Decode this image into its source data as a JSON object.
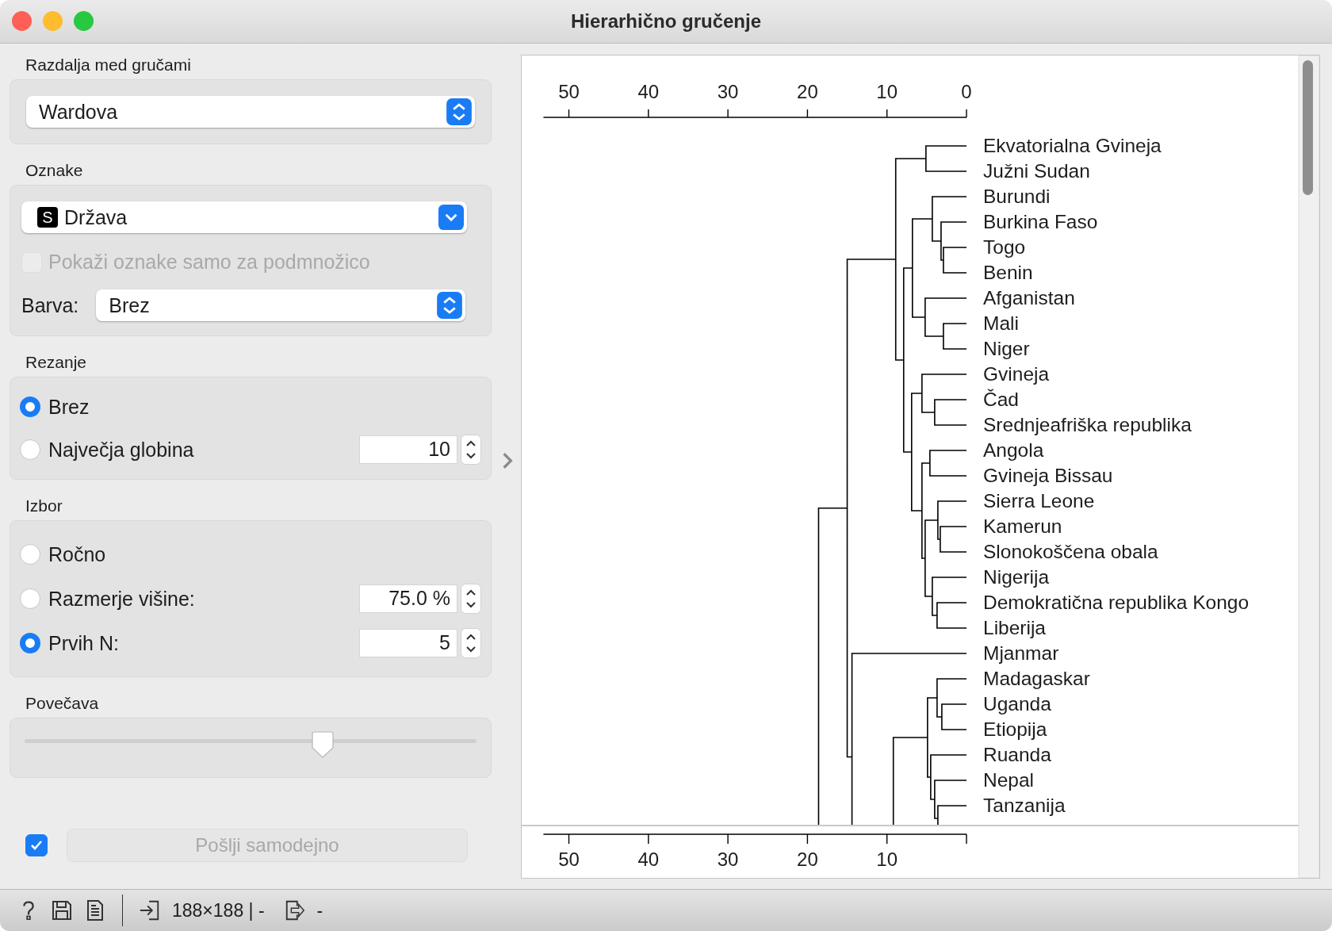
{
  "window": {
    "title": "Hierarhično gručenje"
  },
  "linkage": {
    "label": "Razdalja med gručami",
    "value": "Wardova"
  },
  "annotations": {
    "label": "Oznake",
    "type_badge": "S",
    "value": "Država",
    "subset_checkbox": {
      "label": "Pokaži oznake samo za podmnožico",
      "checked": false,
      "disabled": true
    },
    "color": {
      "label": "Barva:",
      "value": "Brez"
    }
  },
  "pruning": {
    "label": "Rezanje",
    "options": [
      {
        "label": "Brez",
        "selected": true
      },
      {
        "label": "Največja globina",
        "selected": false,
        "value": "10"
      }
    ]
  },
  "selection": {
    "label": "Izbor",
    "options": [
      {
        "label": "Ročno",
        "selected": false
      },
      {
        "label": "Razmerje višine:",
        "selected": false,
        "value": "75.0 %"
      },
      {
        "label": "Prvih N:",
        "selected": true,
        "value": "5"
      }
    ]
  },
  "zoom": {
    "label": "Povečava",
    "level": 0.66
  },
  "auto_send": {
    "checked": true,
    "label": "Pošlji samodejno",
    "disabled": true
  },
  "dendrogram": {
    "top_axis": [
      "50",
      "40",
      "30",
      "20",
      "10",
      "0"
    ],
    "bottom_axis": [
      "50",
      "40",
      "30",
      "20",
      "10"
    ],
    "leaves": [
      "Ekvatorialna Gvineja",
      "Južni Sudan",
      "Burundi",
      "Burkina Faso",
      "Togo",
      "Benin",
      "Afganistan",
      "Mali",
      "Niger",
      "Gvineja",
      "Čad",
      "Srednjeafriška republika",
      "Angola",
      "Gvineja Bissau",
      "Sierra Leone",
      "Kamerun",
      "Slonokoščena obala",
      "Nigerija",
      "Demokratična republika Kongo",
      "Liberija",
      "Mjanmar",
      "Madagaskar",
      "Uganda",
      "Etiopija",
      "Ruanda",
      "Nepal",
      "Tanzanija"
    ]
  },
  "status_bar": {
    "input": "188×188 | -",
    "output": "-"
  }
}
